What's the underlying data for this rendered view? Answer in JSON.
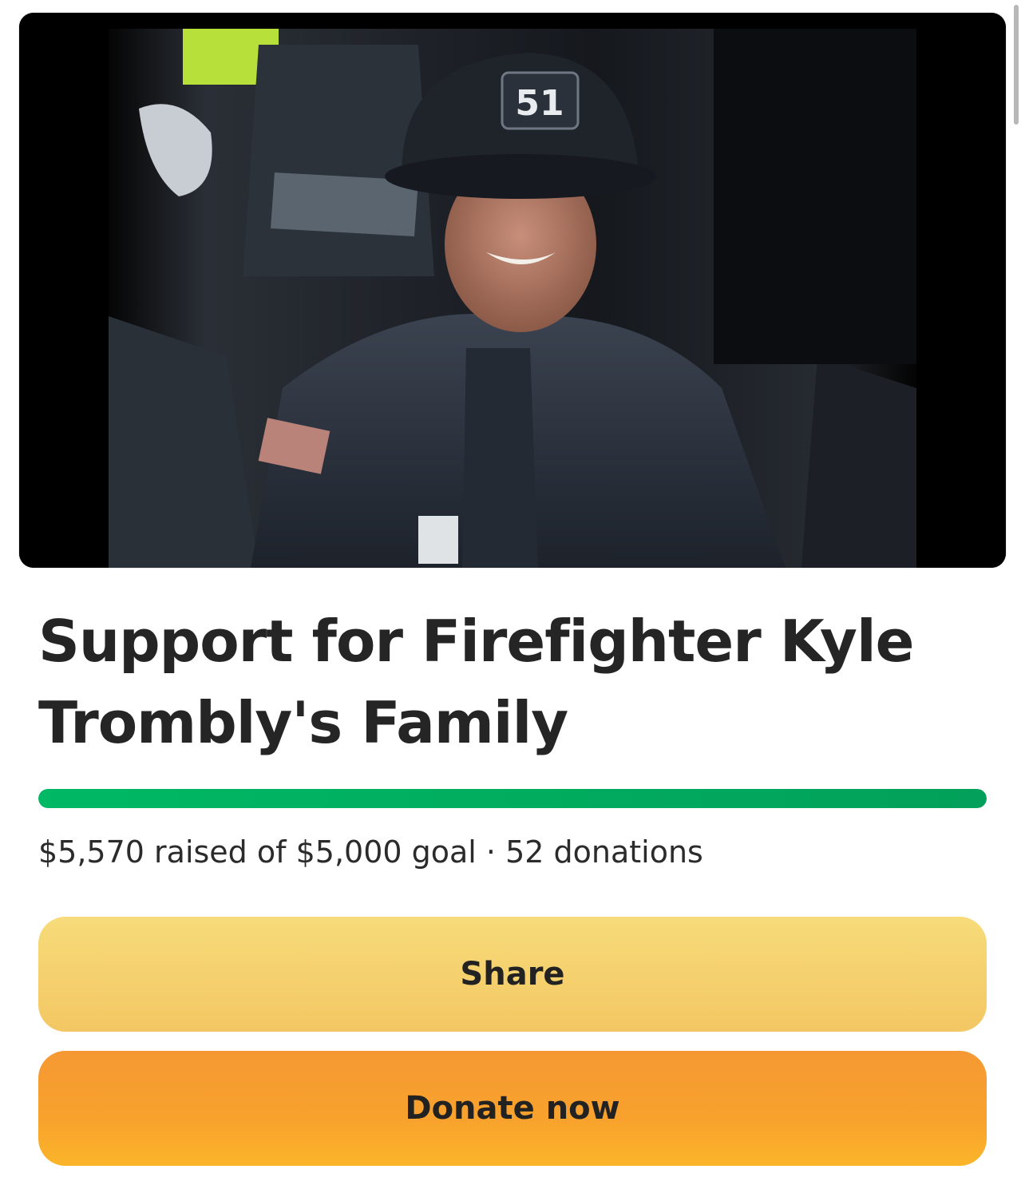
{
  "campaign": {
    "hero_image": "firefighter-photo",
    "helmet_number": "51",
    "title": "Support for Firefighter Kyle Trombly's Family",
    "raised_text": "$5,570 raised of $5,000 goal · 52 donations",
    "progress_fraction": 1.0
  },
  "actions": {
    "share_label": "Share",
    "donate_label": "Donate now"
  },
  "colors": {
    "progress": "#00b964",
    "share": "#f5d16f",
    "donate": "#f7a02f"
  }
}
